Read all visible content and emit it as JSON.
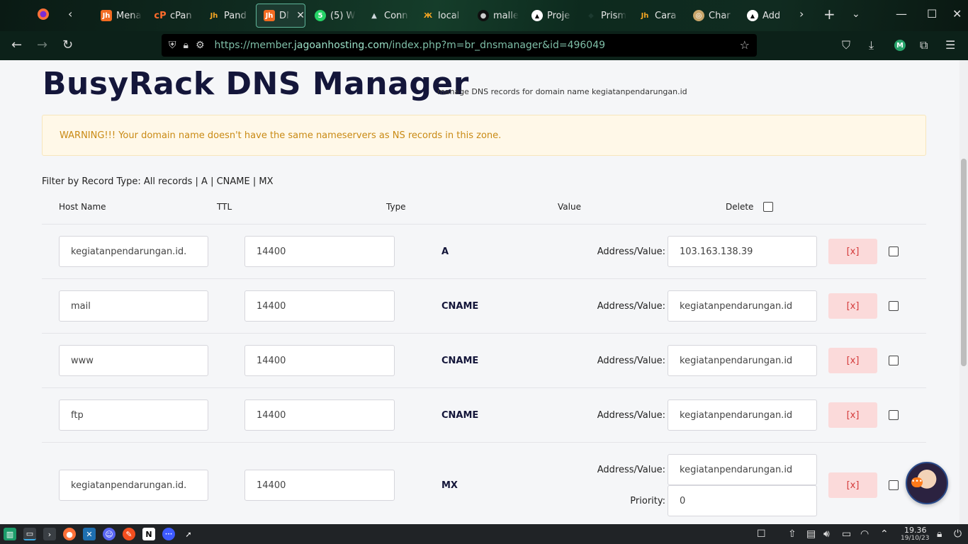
{
  "browser": {
    "tabs": [
      {
        "label": "Mena",
        "icon": "jagoanhosting-icon",
        "color": "#f26b21"
      },
      {
        "label": "cPan",
        "icon": "cpanel-icon",
        "color": "#ff6c2c"
      },
      {
        "label": "Pand",
        "icon": "jagoanhosting-icon",
        "color": "#f26b21"
      },
      {
        "label": "DN",
        "icon": "jagoanhosting-icon",
        "color": "#f26b21",
        "active": true
      },
      {
        "label": "(5) W",
        "icon": "whatsapp-icon",
        "color": "#25d366"
      },
      {
        "label": "Conn",
        "icon": "arch-icon",
        "color": "#9ab"
      },
      {
        "label": "local",
        "icon": "xampp-icon",
        "color": "#f26b21"
      },
      {
        "label": "malle",
        "icon": "github-icon",
        "color": "#222"
      },
      {
        "label": "Proje",
        "icon": "vercel-icon",
        "color": "#000"
      },
      {
        "label": "Prism",
        "icon": "prisma-icon",
        "color": "#2d3748"
      },
      {
        "label": "Cara",
        "icon": "jagoanhosting-icon",
        "color": "#f26b21"
      },
      {
        "label": "Char",
        "icon": "globe-icon",
        "color": "#c9a66b"
      },
      {
        "label": "Add",
        "icon": "vercel-icon",
        "color": "#000"
      }
    ],
    "url_prefix": "https://member.",
    "url_domain": "jagoanhosting.com",
    "url_suffix": "/index.php?m=br_dnsmanager&id=496049",
    "profile_initial": "M"
  },
  "page": {
    "title": "BusyRack DNS Manager",
    "subtitle": "manage DNS records for domain name kegiatanpendarungan.id",
    "warning": "WARNING!!! Your domain name doesn't have the same nameservers as NS records in this zone.",
    "filter": {
      "prefix": "Filter by Record Type: ",
      "all": "All records",
      "sep1": " | ",
      "a": "A",
      "sep2": " | ",
      "cname": "CNAME",
      "sep3": " | ",
      "mx": "MX"
    },
    "columns": {
      "host": "Host Name",
      "ttl": "TTL",
      "type": "Type",
      "value": "Value",
      "delete": "Delete"
    },
    "address_label": "Address/Value:",
    "priority_label": "Priority:",
    "delete_label": "[x]",
    "records": [
      {
        "host": "kegiatanpendarungan.id.",
        "ttl": "14400",
        "type": "A",
        "value": "103.163.138.39"
      },
      {
        "host": "mail",
        "ttl": "14400",
        "type": "CNAME",
        "value": "kegiatanpendarungan.id"
      },
      {
        "host": "www",
        "ttl": "14400",
        "type": "CNAME",
        "value": "kegiatanpendarungan.id"
      },
      {
        "host": "ftp",
        "ttl": "14400",
        "type": "CNAME",
        "value": "kegiatanpendarungan.id"
      },
      {
        "host": "kegiatanpendarungan.id.",
        "ttl": "14400",
        "type": "MX",
        "value": "kegiatanpendarungan.id",
        "priority": "0"
      }
    ]
  },
  "taskbar": {
    "time": "19.36",
    "date": "19/10/23"
  }
}
